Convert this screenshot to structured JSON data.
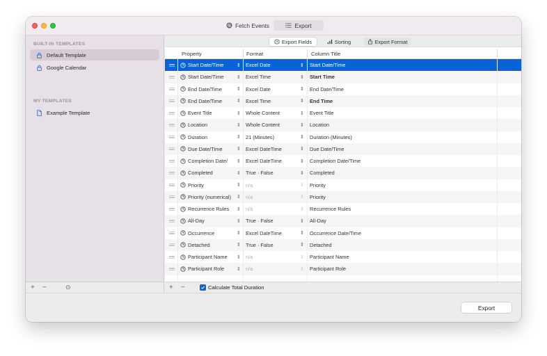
{
  "titlebar": {
    "fetch_label": "Fetch Events",
    "export_label": "Export",
    "fetch_icon": "search-icon",
    "export_icon": "list-icon"
  },
  "sidebar": {
    "builtin_header": "BUILT-IN TEMPLATES",
    "builtin_items": [
      {
        "label": "Default Template",
        "icon": "lock-icon",
        "selected": true
      },
      {
        "label": "Google Calendar",
        "icon": "lock-icon",
        "selected": false
      }
    ],
    "my_header": "MY TEMPLATES",
    "my_items": [
      {
        "label": "Example Template",
        "icon": "document-icon"
      }
    ],
    "bottom": {
      "add": "+",
      "remove": "−",
      "more": "⊙"
    }
  },
  "tabs": {
    "export_fields": "Export Fields",
    "sorting": "Sorting",
    "export_format": "Export Format"
  },
  "table": {
    "headers": {
      "property": "Property",
      "format": "Format",
      "column_title": "Column Title"
    },
    "rows": [
      {
        "property": "Start Date/Time",
        "format": "Excel Date",
        "column": "Start Date/Time",
        "selected": true,
        "dim_format": false,
        "bold": false
      },
      {
        "property": "Start Date/Time",
        "format": "Excel Time",
        "column": "Start Time",
        "selected": false,
        "dim_format": false,
        "bold": true
      },
      {
        "property": "End Date/Time",
        "format": "Excel Date",
        "column": "End Date/Time",
        "selected": false,
        "dim_format": false,
        "bold": false
      },
      {
        "property": "End Date/Time",
        "format": "Excel Time",
        "column": "End Time",
        "selected": false,
        "dim_format": false,
        "bold": true
      },
      {
        "property": "Event Title",
        "format": "Whole Content",
        "column": "Event Title",
        "selected": false,
        "dim_format": false,
        "bold": false
      },
      {
        "property": "Location",
        "format": "Whole Content",
        "column": "Location",
        "selected": false,
        "dim_format": false,
        "bold": false
      },
      {
        "property": "Duration",
        "format": "21 (Minutes)",
        "column": "Duration (Minutes)",
        "selected": false,
        "dim_format": false,
        "bold": false
      },
      {
        "property": "Due Date/Time",
        "format": "Excel DateTime",
        "column": "Due Date/Time",
        "selected": false,
        "dim_format": false,
        "bold": false
      },
      {
        "property": "Completion Date/",
        "format": "Excel DateTime",
        "column": "Completion Date/Time",
        "selected": false,
        "dim_format": false,
        "bold": false
      },
      {
        "property": "Completed",
        "format": "True · False",
        "column": "Completed",
        "selected": false,
        "dim_format": false,
        "bold": false
      },
      {
        "property": "Priority",
        "format": "n/a",
        "column": "Priority",
        "selected": false,
        "dim_format": true,
        "bold": false
      },
      {
        "property": "Priority (numerical)",
        "format": "n/a",
        "column": "Priority",
        "selected": false,
        "dim_format": true,
        "bold": false
      },
      {
        "property": "Recurrence Rules",
        "format": "n/a",
        "column": "Recurrence Rules",
        "selected": false,
        "dim_format": true,
        "bold": false
      },
      {
        "property": "All-Day",
        "format": "True · False",
        "column": "All-Day",
        "selected": false,
        "dim_format": false,
        "bold": false
      },
      {
        "property": "Occurrence",
        "format": "Excel DateTime",
        "column": "Occurrence Date/Time",
        "selected": false,
        "dim_format": false,
        "bold": false
      },
      {
        "property": "Detached",
        "format": "True · False",
        "column": "Detached",
        "selected": false,
        "dim_format": false,
        "bold": false
      },
      {
        "property": "Participant Name",
        "format": "n/a",
        "column": "Participant Name",
        "selected": false,
        "dim_format": true,
        "bold": false
      },
      {
        "property": "Participant Role",
        "format": "n/a",
        "column": "Participant Role",
        "selected": false,
        "dim_format": true,
        "bold": false
      }
    ]
  },
  "bottom_bar": {
    "add": "+",
    "remove": "−",
    "calc_total_label": "Calculate Total Duration",
    "calc_total_checked": true
  },
  "footer": {
    "export_button": "Export"
  },
  "colors": {
    "accent": "#0a63d6",
    "sidebar_bg": "#e8e0e8",
    "titlebar_bg": "#f1eaf1"
  }
}
